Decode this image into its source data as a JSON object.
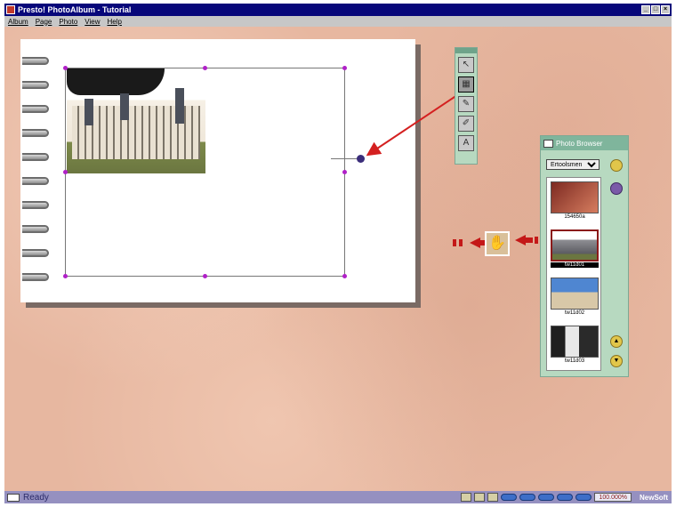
{
  "window": {
    "title": "Presto! PhotoAlbum - Tutorial",
    "controls": [
      "_",
      "□",
      "×"
    ]
  },
  "menu": [
    "Album",
    "Page",
    "Photo",
    "View",
    "Help"
  ],
  "tools": [
    {
      "icon": "pointer-icon",
      "glyph": "↖"
    },
    {
      "icon": "frame-tool-icon",
      "glyph": "▦"
    },
    {
      "icon": "pen-icon",
      "glyph": "✎"
    },
    {
      "icon": "brush-icon",
      "glyph": "✐"
    },
    {
      "icon": "text-tool-icon",
      "glyph": "A"
    }
  ],
  "photo_browser": {
    "title": "Photo Browser",
    "folder": "Ertoolsmen",
    "thumbnails": [
      {
        "label": "154650a",
        "selected": false,
        "color": "#b04a3a"
      },
      {
        "label": "tw11d01",
        "selected": true,
        "color": "#6a6a70"
      },
      {
        "label": "tw11d02",
        "selected": false,
        "color": "#4f86d1"
      },
      {
        "label": "tw11d03",
        "selected": false,
        "color": "#2a2a2a"
      }
    ]
  },
  "status": {
    "text": "Ready",
    "zoom": "100.000%",
    "brand": "NewSoft"
  }
}
